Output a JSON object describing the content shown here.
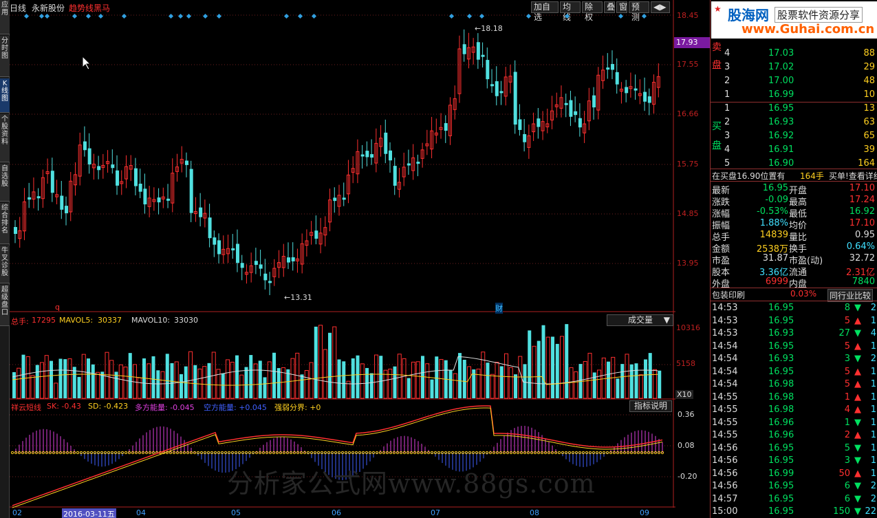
{
  "left_tabs": [
    {
      "label": "应用"
    },
    {
      "label": "分时图"
    },
    {
      "label": "K线图"
    },
    {
      "label": "个股资料"
    },
    {
      "label": "自选股"
    },
    {
      "label": "综合排名"
    },
    {
      "label": "牛叉诊股"
    },
    {
      "label": "超级盘口"
    }
  ],
  "header": {
    "period": "日线",
    "stock": "永新股份",
    "indicator": "趋势线黑马"
  },
  "toolbar": [
    "加自选",
    "均线",
    "除权",
    "叠",
    "窗",
    "预测",
    "◀▶"
  ],
  "price_axis": [
    "18.45",
    "17.55",
    "16.66",
    "15.75",
    "14.85",
    "13.95"
  ],
  "current_price_tag": "17.93",
  "annotations": {
    "high": "18.18",
    "low": "13.31",
    "q_mark": "q",
    "cai_mark": "财"
  },
  "volume": {
    "label": "总手:",
    "value": "17295",
    "ma5_label": "MAVOL5:",
    "ma5": "30337",
    "ma10_label": "MAVOL10:",
    "ma10": "33030",
    "dropdown": "成交量",
    "axis": [
      "10316",
      "5158"
    ],
    "unit": "X10"
  },
  "indicator_panel": {
    "name": "祥云短线",
    "sk": "SK: -0.43",
    "sd": "SD: -0.423",
    "duo": "多方能量: -0.045",
    "kong": "空方能量: +0.045",
    "line": "强弱分界: +0",
    "help": "指标说明",
    "axis": [
      "0.36",
      "0.08",
      "-0.20"
    ]
  },
  "date_axis": [
    "02",
    "2016-03-11五",
    "04",
    "05",
    "06",
    "07",
    "08",
    "09"
  ],
  "watermark": "分析家公式网www.88gs.com",
  "logo": {
    "name": "股海网",
    "slogan": "股票软件资源分享",
    "url": "www.Guhai.com.cn"
  },
  "orderbook": {
    "sell": [
      {
        "lvl": "4",
        "price": "17.03",
        "vol": "88"
      },
      {
        "lvl": "3",
        "price": "17.02",
        "vol": "29"
      },
      {
        "lvl": "2",
        "price": "17.00",
        "vol": "48"
      },
      {
        "lvl": "1",
        "price": "16.99",
        "vol": "10"
      }
    ],
    "buy": [
      {
        "lvl": "1",
        "price": "16.95",
        "vol": "13"
      },
      {
        "lvl": "2",
        "price": "16.93",
        "vol": "63"
      },
      {
        "lvl": "3",
        "price": "16.92",
        "vol": "65"
      },
      {
        "lvl": "4",
        "price": "16.91",
        "vol": "39"
      },
      {
        "lvl": "5",
        "price": "16.90",
        "vol": "164"
      }
    ],
    "sell_label": [
      "委",
      "卖",
      "盘"
    ],
    "buy_label": [
      "买",
      "盘"
    ]
  },
  "bid_line": {
    "text": "在买盘16.90位置有",
    "qty": "164手",
    "link": "买单!查看详细"
  },
  "quote": [
    [
      "最新",
      "16.95",
      "开盘",
      "17.10"
    ],
    [
      "涨跌",
      "-0.09",
      "最高",
      "17.24"
    ],
    [
      "涨幅",
      "-0.53%",
      "最低",
      "16.92"
    ],
    [
      "振幅",
      "1.88%",
      "均价",
      "17.10"
    ],
    [
      "总手",
      "14839",
      "量比",
      "0.95"
    ],
    [
      "金额",
      "2538万",
      "换手",
      "0.64%"
    ],
    [
      "市盈",
      "31.87",
      "市盈(动)",
      "32.72"
    ],
    [
      "股本",
      "3.36亿",
      "流通",
      "2.31亿"
    ],
    [
      "外盘",
      "6999",
      "内盘",
      "7840"
    ]
  ],
  "industry": {
    "name": "包装印刷",
    "pct": "0.03%",
    "btn": "同行业比较"
  },
  "ticks": [
    [
      "14:53",
      "16.95",
      "8",
      "down",
      "2"
    ],
    [
      "14:53",
      "16.95",
      "5",
      "up",
      "1"
    ],
    [
      "14:53",
      "16.93",
      "27",
      "down",
      "4"
    ],
    [
      "14:54",
      "16.95",
      "5",
      "up",
      "1"
    ],
    [
      "14:54",
      "16.93",
      "3",
      "down",
      "2"
    ],
    [
      "14:54",
      "16.95",
      "5",
      "up",
      "1"
    ],
    [
      "14:54",
      "16.98",
      "5",
      "up",
      "1"
    ],
    [
      "14:55",
      "16.98",
      "1",
      "up",
      "1"
    ],
    [
      "14:55",
      "16.98",
      "4",
      "up",
      "1"
    ],
    [
      "14:55",
      "16.96",
      "1",
      "down",
      "1"
    ],
    [
      "14:55",
      "16.96",
      "2",
      "up",
      "1"
    ],
    [
      "14:56",
      "16.95",
      "5",
      "down",
      "1"
    ],
    [
      "14:56",
      "16.95",
      "3",
      "down",
      "1"
    ],
    [
      "14:56",
      "16.99",
      "50",
      "up",
      "1"
    ],
    [
      "14:56",
      "16.95",
      "6",
      "down",
      "2"
    ],
    [
      "14:57",
      "16.95",
      "6",
      "down",
      "2"
    ],
    [
      "15:00",
      "16.95",
      "150",
      "down",
      "22"
    ]
  ]
}
